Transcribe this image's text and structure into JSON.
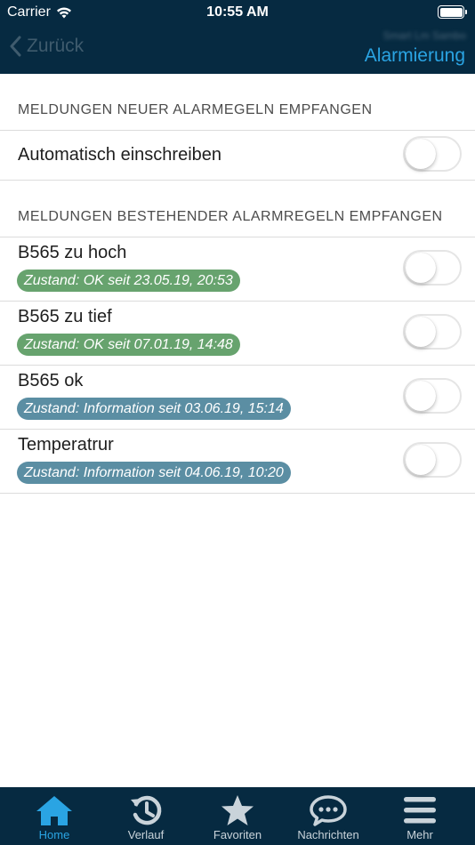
{
  "status_bar": {
    "carrier": "Carrier",
    "time": "10:55 AM"
  },
  "nav": {
    "back_label": "Zurück",
    "subtitle": "Smart Lm Sambo",
    "title": "Alarmierung"
  },
  "section_new": {
    "header": "MELDUNGEN NEUER ALARMEGELN EMPFANGEN",
    "rows": [
      {
        "label": "Automatisch einschreiben",
        "enabled": false
      }
    ]
  },
  "section_existing": {
    "header": "MELDUNGEN BESTEHENDER ALARMREGELN EMPFANGEN",
    "rows": [
      {
        "label": "B565 zu hoch",
        "status": "Zustand: OK seit 23.05.19, 20:53",
        "status_color": "#67a36e",
        "enabled": false
      },
      {
        "label": "B565 zu tief",
        "status": "Zustand: OK seit 07.01.19, 14:48",
        "status_color": "#67a36e",
        "enabled": false
      },
      {
        "label": "B565 ok",
        "status": "Zustand: Information seit 03.06.19, 15:14",
        "status_color": "#5b8ea3",
        "enabled": false
      },
      {
        "label": "Temperatrur",
        "status": "Zustand: Information seit 04.06.19, 10:20",
        "status_color": "#5b8ea3",
        "enabled": false
      }
    ]
  },
  "tabbar": {
    "items": [
      {
        "label": "Home",
        "icon": "home-icon",
        "active": true
      },
      {
        "label": "Verlauf",
        "icon": "history-icon",
        "active": false
      },
      {
        "label": "Favoriten",
        "icon": "star-icon",
        "active": false
      },
      {
        "label": "Nachrichten",
        "icon": "chat-bubble-icon",
        "active": false
      },
      {
        "label": "Mehr",
        "icon": "menu-icon",
        "active": false
      }
    ]
  },
  "colors": {
    "header_bg": "#062a41",
    "accent": "#2aa4e3",
    "ok_badge": "#67a36e",
    "info_badge": "#5b8ea3"
  }
}
